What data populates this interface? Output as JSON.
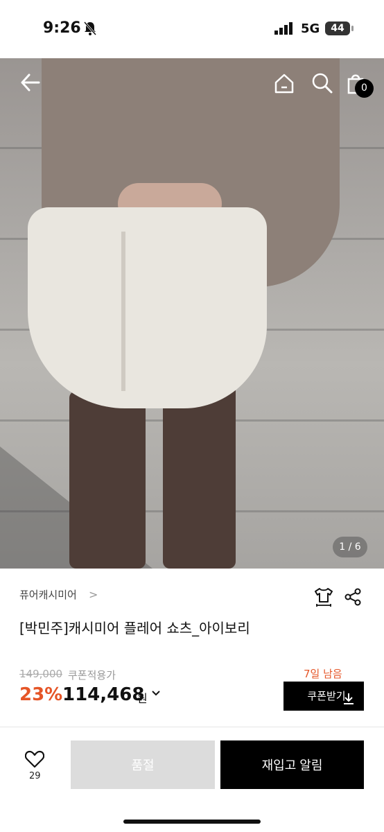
{
  "status": {
    "time": "9:26",
    "network": "5G",
    "battery": "44"
  },
  "gallery": {
    "counter": "1 / 6",
    "cart_count": "0"
  },
  "product": {
    "brand": "퓨어캐시미어",
    "title": "[박민주]캐시미어 플레어 쇼츠_아이보리",
    "original_price": "149,000",
    "coupon_note": "쿠폰적용가",
    "discount": "23%",
    "price": "114,468",
    "currency": "원",
    "days_left": "7일 남음",
    "coupon_button": "쿠폰받기"
  },
  "bottom_bar": {
    "like_count": "29",
    "soldout_label": "품절",
    "restock_label": "재입고 알림"
  },
  "colors": {
    "accent": "#e55527",
    "primary": "#000000",
    "disabled": "#dcdcdc"
  }
}
